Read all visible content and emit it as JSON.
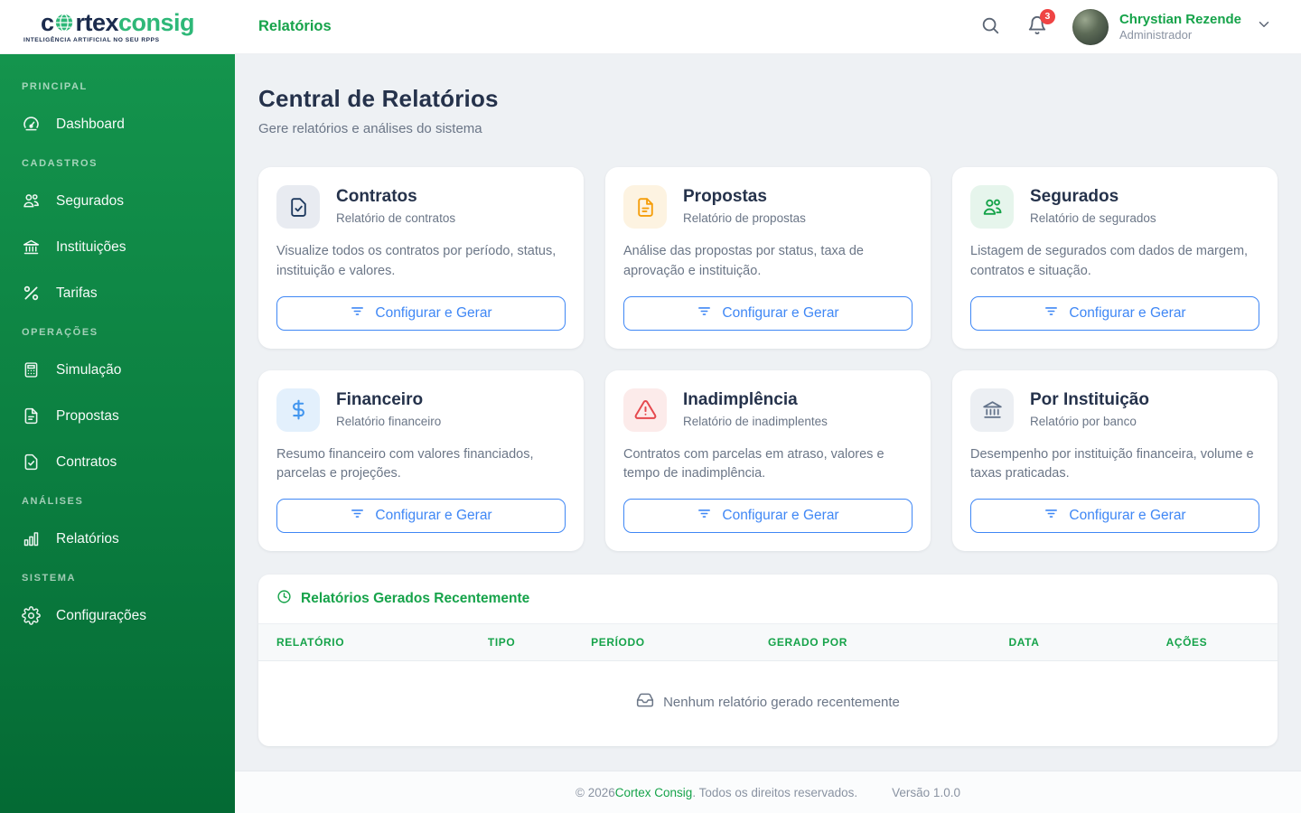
{
  "brand": {
    "word_cortex": "c",
    "word_cortex_rest": "rtex",
    "word_consig": "consig",
    "tagline": "INTELIGÊNCIA ARTIFICIAL NO SEU RPPS"
  },
  "header": {
    "page_title": "Relatórios",
    "notification_count": "3",
    "user": {
      "name": "Chrystian Rezende",
      "role": "Administrador"
    }
  },
  "sidebar": {
    "sections": [
      {
        "label": "PRINCIPAL",
        "items": [
          {
            "label": "Dashboard",
            "icon": "gauge-icon"
          }
        ]
      },
      {
        "label": "CADASTROS",
        "items": [
          {
            "label": "Segurados",
            "icon": "users-icon"
          },
          {
            "label": "Instituições",
            "icon": "bank-icon"
          },
          {
            "label": "Tarifas",
            "icon": "percent-icon"
          }
        ]
      },
      {
        "label": "OPERAÇÕES",
        "items": [
          {
            "label": "Simulação",
            "icon": "calculator-icon"
          },
          {
            "label": "Propostas",
            "icon": "file-text-icon"
          },
          {
            "label": "Contratos",
            "icon": "file-check-icon"
          }
        ]
      },
      {
        "label": "ANÁLISES",
        "items": [
          {
            "label": "Relatórios",
            "icon": "bar-chart-icon"
          }
        ]
      },
      {
        "label": "SISTEMA",
        "items": [
          {
            "label": "Configurações",
            "icon": "gear-icon"
          }
        ]
      }
    ]
  },
  "main": {
    "title": "Central de Relatórios",
    "subtitle": "Gere relatórios e análises do sistema",
    "cards": [
      {
        "title": "Contratos",
        "subtitle": "Relatório de contratos",
        "description": "Visualize todos os contratos por período, status, instituição e valores.",
        "button_label": "Configurar e Gerar",
        "icon": "file-check-icon",
        "icon_color": "#1e3a5f",
        "icon_bg": "#e8ebf1"
      },
      {
        "title": "Propostas",
        "subtitle": "Relatório de propostas",
        "description": "Análise das propostas por status, taxa de aprovação e instituição.",
        "button_label": "Configurar e Gerar",
        "icon": "file-text-icon",
        "icon_color": "#f59e0b",
        "icon_bg": "#fdf3e1"
      },
      {
        "title": "Segurados",
        "subtitle": "Relatório de segurados",
        "description": "Listagem de segurados com dados de margem, contratos e situação.",
        "button_label": "Configurar e Gerar",
        "icon": "users-icon",
        "icon_color": "#16a34a",
        "icon_bg": "#e6f5ec"
      },
      {
        "title": "Financeiro",
        "subtitle": "Relatório financeiro",
        "description": "Resumo financeiro com valores financiados, parcelas e projeções.",
        "button_label": "Configurar e Gerar",
        "icon": "dollar-icon",
        "icon_color": "#4296ef",
        "icon_bg": "#e3f0fc"
      },
      {
        "title": "Inadimplência",
        "subtitle": "Relatório de inadimplentes",
        "description": "Contratos com parcelas em atraso, valores e tempo de inadimplência.",
        "button_label": "Configurar e Gerar",
        "icon": "warning-icon",
        "icon_color": "#e5484d",
        "icon_bg": "#fcebea"
      },
      {
        "title": "Por Instituição",
        "subtitle": "Relatório por banco",
        "description": "Desempenho por instituição financeira, volume e taxas praticadas.",
        "button_label": "Configurar e Gerar",
        "icon": "bank-icon",
        "icon_color": "#64748b",
        "icon_bg": "#eceff3"
      }
    ],
    "recent": {
      "title": "Relatórios Gerados Recentemente",
      "columns": [
        "RELATÓRIO",
        "TIPO",
        "PERÍODO",
        "GERADO POR",
        "DATA",
        "AÇÕES"
      ],
      "empty_text": "Nenhum relatório gerado recentemente"
    }
  },
  "footer": {
    "prefix": "© 2026 ",
    "brand": "Cortex Consig",
    "rights": ". Todos os direitos reservados.",
    "version": "Versão 1.0.0"
  },
  "colors": {
    "accent_green": "#16a34a",
    "logo_green": "#2eb878",
    "navy": "#1b2b4d",
    "button_blue": "#3f87f5",
    "badge_red": "#ef4444",
    "sidebar_gradient_top": "#14944d",
    "sidebar_gradient_bottom": "#046a34"
  }
}
